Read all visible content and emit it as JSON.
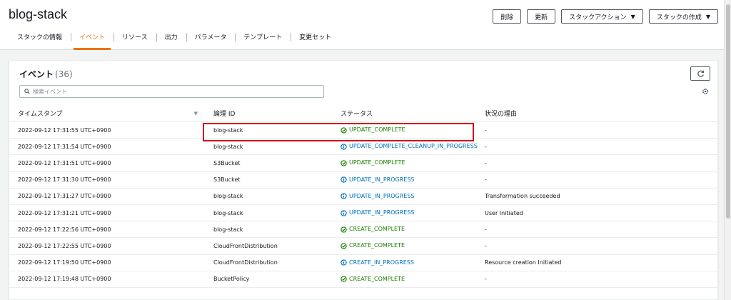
{
  "header": {
    "title": "blog-stack",
    "buttons": {
      "delete": "削除",
      "update": "更新",
      "stack_actions": "スタックアクション",
      "create_stack": "スタックの作成"
    },
    "tabs": [
      "スタックの情報",
      "イベント",
      "リソース",
      "出力",
      "パラメータ",
      "テンプレート",
      "変更セット"
    ],
    "active_tab": "イベント"
  },
  "events": {
    "title": "イベント",
    "count": "(36)",
    "search_placeholder": "検索イベント",
    "columns": {
      "timestamp": "タイムスタンプ",
      "logical_id": "論理 ID",
      "status": "ステータス",
      "reason": "状況の理由"
    },
    "rows": [
      {
        "timestamp": "2022-09-12 17:31:55 UTC+0900",
        "logical_id": "blog-stack",
        "status": "UPDATE_COMPLETE",
        "kind": "ok",
        "reason": "-"
      },
      {
        "timestamp": "2022-09-12 17:31:54 UTC+0900",
        "logical_id": "blog-stack",
        "status": "UPDATE_COMPLETE_CLEANUP_IN_PROGRESS",
        "kind": "info",
        "reason": "-"
      },
      {
        "timestamp": "2022-09-12 17:31:51 UTC+0900",
        "logical_id": "S3Bucket",
        "status": "UPDATE_COMPLETE",
        "kind": "ok",
        "reason": "-"
      },
      {
        "timestamp": "2022-09-12 17:31:30 UTC+0900",
        "logical_id": "S3Bucket",
        "status": "UPDATE_IN_PROGRESS",
        "kind": "info",
        "reason": "-"
      },
      {
        "timestamp": "2022-09-12 17:31:27 UTC+0900",
        "logical_id": "blog-stack",
        "status": "UPDATE_IN_PROGRESS",
        "kind": "info",
        "reason": "Transformation succeeded"
      },
      {
        "timestamp": "2022-09-12 17:31:21 UTC+0900",
        "logical_id": "blog-stack",
        "status": "UPDATE_IN_PROGRESS",
        "kind": "info",
        "reason": "User Initiated"
      },
      {
        "timestamp": "2022-09-12 17:22:56 UTC+0900",
        "logical_id": "blog-stack",
        "status": "CREATE_COMPLETE",
        "kind": "ok",
        "reason": "-"
      },
      {
        "timestamp": "2022-09-12 17:22:55 UTC+0900",
        "logical_id": "CloudFrontDistribution",
        "status": "CREATE_COMPLETE",
        "kind": "ok",
        "reason": "-"
      },
      {
        "timestamp": "2022-09-12 17:19:50 UTC+0900",
        "logical_id": "CloudFrontDistribution",
        "status": "CREATE_IN_PROGRESS",
        "kind": "info",
        "reason": "Resource creation Initiated"
      },
      {
        "timestamp": "2022-09-12 17:19:48 UTC+0900",
        "logical_id": "BucketPolicy",
        "status": "CREATE_COMPLETE",
        "kind": "ok",
        "reason": "-"
      }
    ]
  },
  "icons": {
    "ok": "check-circle-icon",
    "info": "info-circle-icon",
    "refresh": "refresh-icon",
    "search": "search-icon",
    "settings": "gear-icon"
  },
  "colors": {
    "accent": "#ec7211",
    "success": "#1d8102",
    "info": "#0073bb",
    "highlight": "#d0021b"
  }
}
